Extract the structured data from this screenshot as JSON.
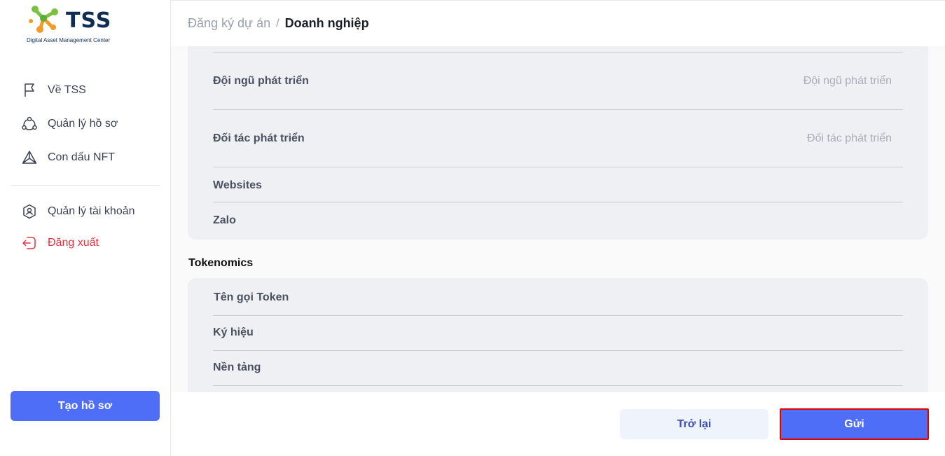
{
  "logo": {
    "name": "TSS",
    "tagline": "Digital Asset Management Center"
  },
  "sidebar": {
    "items": [
      {
        "label": "Về TSS",
        "icon": "flag-icon"
      },
      {
        "label": "Quản lý hồ sơ",
        "icon": "network-icon"
      },
      {
        "label": "Con dấu NFT",
        "icon": "triangle-icon"
      },
      {
        "label": "Quản lý tài khoản",
        "icon": "user-shield-icon"
      },
      {
        "label": "Đăng xuất",
        "icon": "logout-icon"
      }
    ],
    "create_label": "Tạo hồ sơ"
  },
  "breadcrumb": {
    "parent": "Đăng ký dự án",
    "separator": "/",
    "current": "Doanh nghiệp"
  },
  "form": {
    "dev_team": {
      "label": "Đội ngũ phát triển",
      "placeholder": "Đội ngũ phát triển"
    },
    "dev_partner": {
      "label": "Đối tác phát triển",
      "placeholder": "Đối tác phát triển"
    },
    "websites": {
      "label": "Websites"
    },
    "zalo": {
      "label": "Zalo"
    },
    "tokenomics_title": "Tokenomics",
    "token_name": {
      "label": "Tên gọi Token"
    },
    "symbol": {
      "label": "Ký hiệu"
    },
    "platform": {
      "label": "Nền tảng"
    }
  },
  "footer": {
    "back_label": "Trở lại",
    "send_label": "Gửi"
  },
  "colors": {
    "accent": "#4f6ef7",
    "logout": "#e5333f",
    "highlight_border": "#e00000"
  }
}
